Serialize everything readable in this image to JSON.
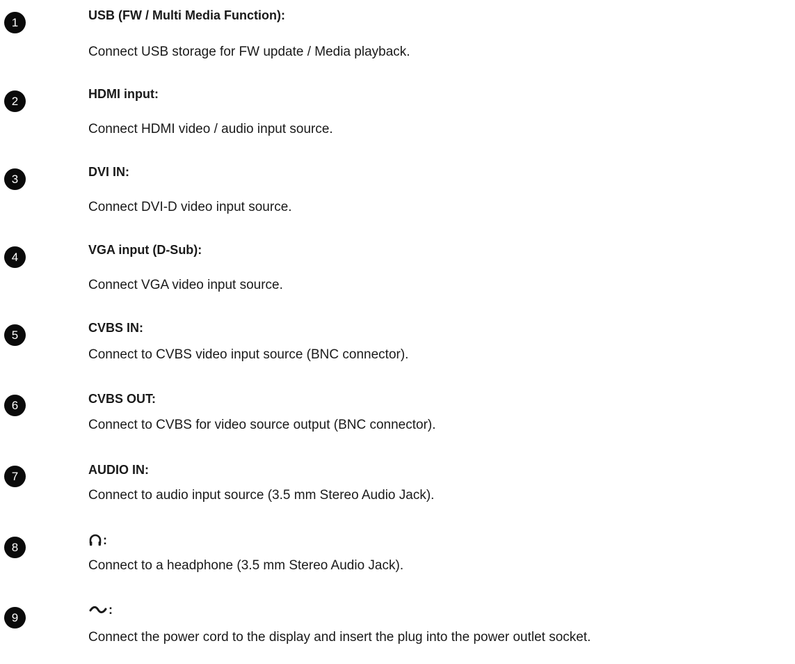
{
  "items": [
    {
      "number": "1",
      "title": "USB (FW / Multi Media Function):",
      "description": "Connect USB storage for FW update / Media playback."
    },
    {
      "number": "2",
      "title": "HDMI input:",
      "description": "Connect HDMI video / audio input source."
    },
    {
      "number": "3",
      "title": "DVI IN:",
      "description": "Connect DVI-D video input source."
    },
    {
      "number": "4",
      "title": "VGA input (D-Sub):",
      "description": "Connect VGA video input source."
    },
    {
      "number": "5",
      "title": "CVBS IN:",
      "description": "Connect to CVBS video input source (BNC connector)."
    },
    {
      "number": "6",
      "title": "CVBS OUT:",
      "description": "Connect to CVBS for video source output (BNC connector)."
    },
    {
      "number": "7",
      "title": "AUDIO IN:",
      "description": "Connect to audio input source (3.5 mm Stereo Audio Jack)."
    },
    {
      "number": "8",
      "title": ":",
      "icon": "headphone-icon",
      "description": "Connect to a headphone (3.5 mm Stereo Audio Jack)."
    },
    {
      "number": "9",
      "title": ":",
      "icon": "ac-power-icon",
      "description": "Connect the power cord to the display and insert the plug into the power outlet socket."
    }
  ]
}
